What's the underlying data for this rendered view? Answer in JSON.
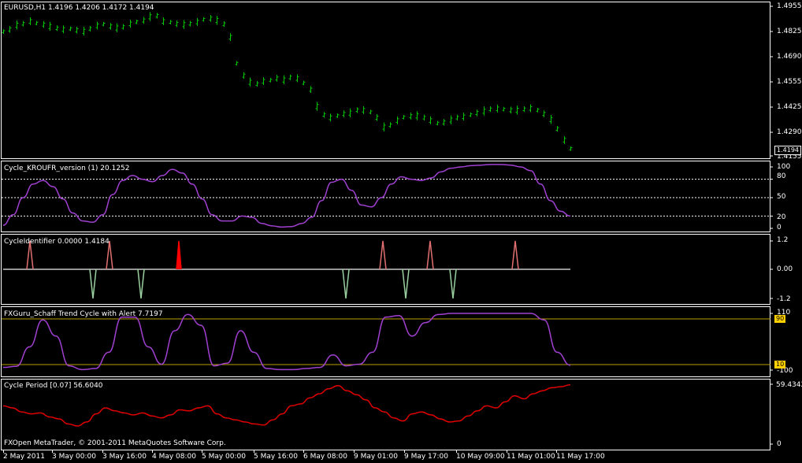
{
  "colors": {
    "background": "#000000",
    "bull_bar": "#00c800",
    "oscillator": "#a040d0",
    "cycle_line": "#c8c8c8",
    "cycle_peak": "#e07070",
    "cycle_trough": "#9ad0a0",
    "cycle_alert": "#ff0000",
    "level_line": "#b8a000",
    "period_line": "#e00000",
    "level_tag_bg": "#ffd000",
    "price_tag_bg": "#000000"
  },
  "price_pane": {
    "title": "EURUSD,H1  1.4196 1.4206 1.4172 1.4194",
    "scale": [
      "1.4955",
      "1.4825",
      "1.4690",
      "1.4555",
      "1.4425",
      "1.4290",
      "1.4155"
    ],
    "current_price": "1.4194"
  },
  "kroufr_pane": {
    "title": "Cycle_KROUFR_version (1) 20.1252",
    "scale": [
      "100",
      "80",
      "50",
      "20",
      "0"
    ]
  },
  "identifier_pane": {
    "title": "CycleIdentifier 0.0000 1.4184",
    "scale": [
      "1.2",
      "0.00",
      "-1.2"
    ]
  },
  "schaff_pane": {
    "title": "FXGuru_Schaff Trend Cycle with Alert 7.7197",
    "scale": [
      "110",
      "-100"
    ],
    "level_tags": [
      "90",
      "10"
    ]
  },
  "period_pane": {
    "title": "Cycle Period [0.07] 56.6040",
    "scale": [
      "59.4342",
      "0"
    ],
    "copyright": "FXOpen MetaTrader, © 2001-2011 MetaQuotes Software Corp."
  },
  "time_axis": [
    "2 May 2011",
    "3 May 00:00",
    "3 May 16:00",
    "4 May 08:00",
    "5 May 00:00",
    "5 May 16:00",
    "6 May 08:00",
    "9 May 01:00",
    "9 May 17:00",
    "10 May 09:00",
    "11 May 01:00",
    "11 May 17:00"
  ],
  "chart_data": [
    {
      "type": "line",
      "title": "EURUSD,H1  1.4196 1.4206 1.4172 1.4194",
      "ylim": [
        1.4155,
        1.4955
      ],
      "y": [
        1.482,
        1.4832,
        1.4855,
        1.4862,
        1.4875,
        1.4865,
        1.4858,
        1.4848,
        1.4838,
        1.4832,
        1.4835,
        1.4828,
        1.4822,
        1.4835,
        1.4852,
        1.486,
        1.4848,
        1.484,
        1.4845,
        1.4862,
        1.4872,
        1.488,
        1.49,
        1.4905,
        1.4875,
        1.487,
        1.4862,
        1.4858,
        1.4862,
        1.4872,
        1.4885,
        1.489,
        1.488,
        1.486,
        1.479,
        1.465,
        1.4585,
        1.455,
        1.454,
        1.4555,
        1.456,
        1.457,
        1.4562,
        1.4575,
        1.457,
        1.4545,
        1.451,
        1.442,
        1.4375,
        1.436,
        1.437,
        1.438,
        1.4385,
        1.44,
        1.44,
        1.439,
        1.436,
        1.431,
        1.432,
        1.4345,
        1.4362,
        1.4368,
        1.437,
        1.436,
        1.4345,
        1.433,
        1.4335,
        1.4348,
        1.436,
        1.4365,
        1.4375,
        1.4385,
        1.4395,
        1.4405,
        1.4408,
        1.4405,
        1.44,
        1.44,
        1.4405,
        1.441,
        1.44,
        1.438,
        1.435,
        1.43,
        1.424,
        1.4194
      ]
    },
    {
      "type": "line",
      "title": "Cycle_KROUFR_version (1) 20.1252",
      "ylim": [
        0,
        100
      ],
      "y": [
        5,
        22,
        50,
        72,
        78,
        68,
        48,
        25,
        12,
        10,
        22,
        55,
        78,
        86,
        80,
        76,
        86,
        96,
        90,
        72,
        48,
        22,
        12,
        12,
        20,
        18,
        8,
        4,
        2,
        3,
        8,
        18,
        45,
        75,
        80,
        62,
        38,
        35,
        50,
        72,
        84,
        80,
        78,
        82,
        92,
        98,
        100,
        102,
        103,
        104,
        104,
        103,
        100,
        94,
        72,
        45,
        28,
        20
      ]
    },
    {
      "type": "line",
      "title": "CycleIdentifier 0.0000 1.4184",
      "ylim": [
        -1.2,
        1.2
      ],
      "x": [
        1,
        2,
        3,
        4,
        5,
        6,
        7,
        8,
        9,
        10,
        11,
        12,
        13
      ],
      "y": [
        1,
        -1,
        1,
        -1,
        1,
        -1,
        1,
        -1,
        1,
        -1,
        1,
        -1,
        1
      ]
    },
    {
      "type": "line",
      "title": "FXGuru_Schaff Trend Cycle with Alert 7.7197",
      "ylim": [
        -100,
        110
      ],
      "y": [
        2,
        4,
        40,
        90,
        60,
        5,
        -2,
        0,
        30,
        95,
        95,
        40,
        8,
        70,
        100,
        80,
        5,
        10,
        70,
        30,
        0,
        -2,
        -2,
        0,
        2,
        25,
        5,
        8,
        30,
        95,
        98,
        60,
        85,
        100,
        102,
        102,
        102,
        102,
        102,
        102,
        102,
        90,
        30,
        6
      ]
    },
    {
      "type": "line",
      "title": "Cycle Period [0.07] 56.6040",
      "ylim": [
        0,
        59.4342
      ],
      "y": [
        38,
        36,
        32,
        30,
        31,
        27,
        25,
        20,
        18,
        22,
        30,
        36,
        33,
        31,
        29,
        31,
        28,
        26,
        29,
        34,
        33,
        36,
        38,
        30,
        26,
        24,
        22,
        20,
        19,
        24,
        30,
        38,
        40,
        46,
        50,
        55,
        58,
        53,
        49,
        44,
        36,
        32,
        26,
        23,
        30,
        32,
        29,
        25,
        22,
        23,
        28,
        33,
        38,
        36,
        42,
        48,
        45,
        50,
        53,
        56,
        57,
        59
      ]
    }
  ]
}
